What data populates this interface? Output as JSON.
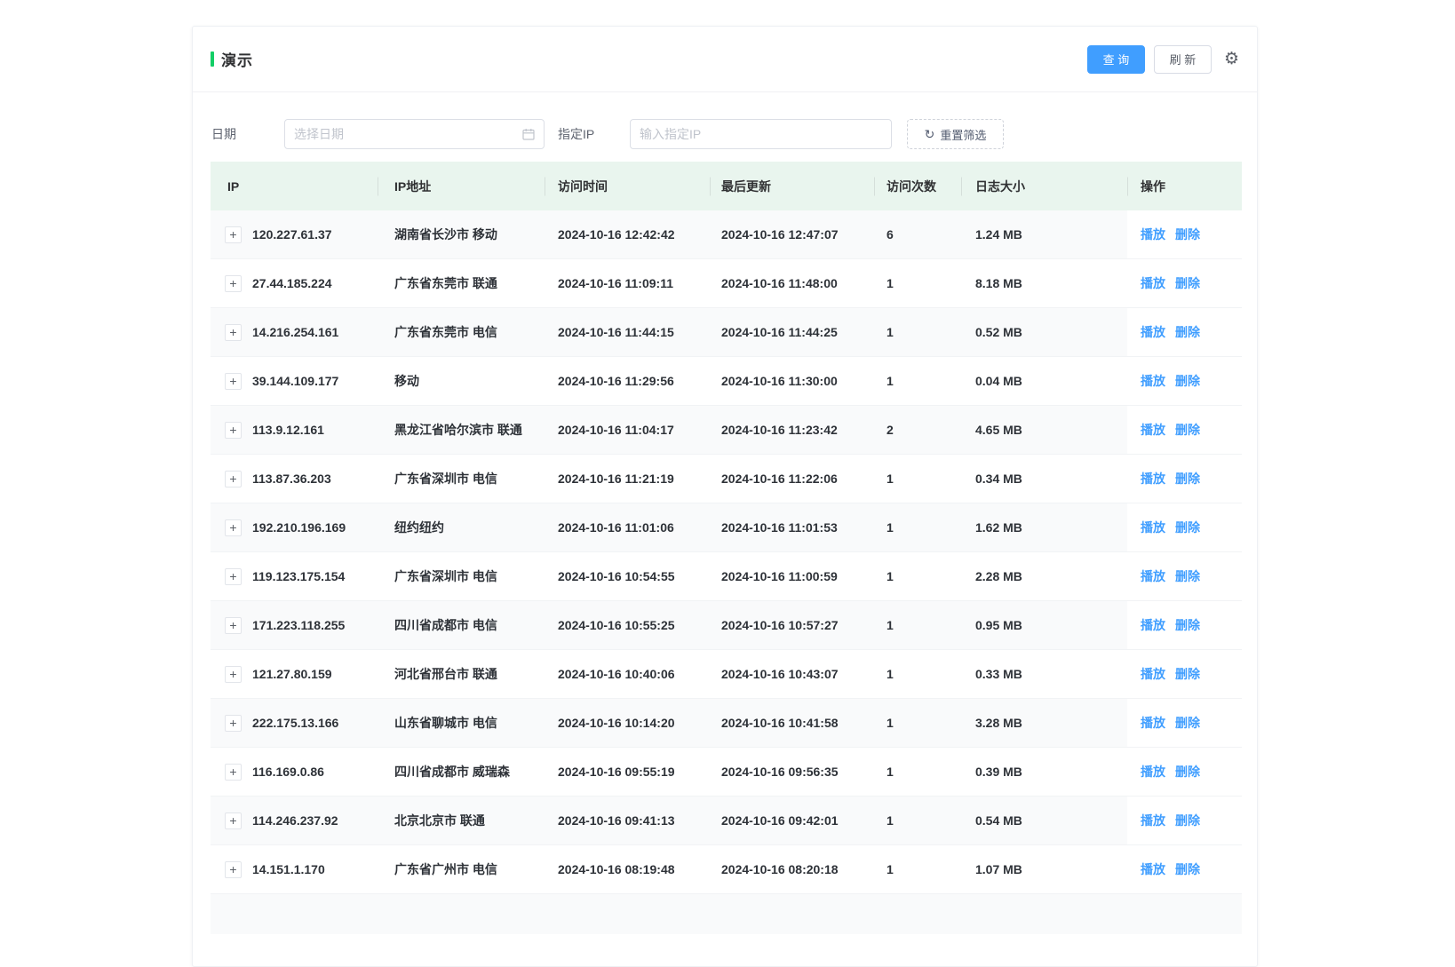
{
  "page": {
    "title": "演示"
  },
  "colors": {
    "accent_green": "#13ce66",
    "primary_blue": "#409eff",
    "table_header_bg": "#e9f5ee",
    "stripe_bg": "#f9fafb",
    "link_blue": "#409eff"
  },
  "toolbar": {
    "query_label": "查 询",
    "refresh_label": "刷 新",
    "settings_icon": "gear-icon"
  },
  "filters": {
    "date_label": "日期",
    "date_placeholder": "选择日期",
    "date_value": "",
    "date_icon": "calendar-icon",
    "ip_label": "指定IP",
    "ip_placeholder": "输入指定IP",
    "ip_value": "",
    "reset_label": "重置筛选",
    "reset_icon": "refresh-icon"
  },
  "table": {
    "expand_icon": "plus-icon",
    "columns": [
      "IP",
      "IP地址",
      "访问时间",
      "最后更新",
      "访问次数",
      "日志大小",
      "操作"
    ],
    "actions": {
      "play": "播放",
      "delete": "删除"
    },
    "rows": [
      {
        "ip": "120.227.61.37",
        "location": "湖南省长沙市 移动",
        "visit_time": "2024-10-16 12:42:42",
        "last_update": "2024-10-16 12:47:07",
        "visits": "6",
        "log_size": "1.24 MB"
      },
      {
        "ip": "27.44.185.224",
        "location": "广东省东莞市 联通",
        "visit_time": "2024-10-16 11:09:11",
        "last_update": "2024-10-16 11:48:00",
        "visits": "1",
        "log_size": "8.18 MB"
      },
      {
        "ip": "14.216.254.161",
        "location": "广东省东莞市 电信",
        "visit_time": "2024-10-16 11:44:15",
        "last_update": "2024-10-16 11:44:25",
        "visits": "1",
        "log_size": "0.52 MB"
      },
      {
        "ip": "39.144.109.177",
        "location": "移动",
        "visit_time": "2024-10-16 11:29:56",
        "last_update": "2024-10-16 11:30:00",
        "visits": "1",
        "log_size": "0.04 MB"
      },
      {
        "ip": "113.9.12.161",
        "location": "黑龙江省哈尔滨市 联通",
        "visit_time": "2024-10-16 11:04:17",
        "last_update": "2024-10-16 11:23:42",
        "visits": "2",
        "log_size": "4.65 MB"
      },
      {
        "ip": "113.87.36.203",
        "location": "广东省深圳市 电信",
        "visit_time": "2024-10-16 11:21:19",
        "last_update": "2024-10-16 11:22:06",
        "visits": "1",
        "log_size": "0.34 MB"
      },
      {
        "ip": "192.210.196.169",
        "location": "纽约纽约",
        "visit_time": "2024-10-16 11:01:06",
        "last_update": "2024-10-16 11:01:53",
        "visits": "1",
        "log_size": "1.62 MB"
      },
      {
        "ip": "119.123.175.154",
        "location": "广东省深圳市 电信",
        "visit_time": "2024-10-16 10:54:55",
        "last_update": "2024-10-16 11:00:59",
        "visits": "1",
        "log_size": "2.28 MB"
      },
      {
        "ip": "171.223.118.255",
        "location": "四川省成都市 电信",
        "visit_time": "2024-10-16 10:55:25",
        "last_update": "2024-10-16 10:57:27",
        "visits": "1",
        "log_size": "0.95 MB"
      },
      {
        "ip": "121.27.80.159",
        "location": "河北省邢台市 联通",
        "visit_time": "2024-10-16 10:40:06",
        "last_update": "2024-10-16 10:43:07",
        "visits": "1",
        "log_size": "0.33 MB"
      },
      {
        "ip": "222.175.13.166",
        "location": "山东省聊城市 电信",
        "visit_time": "2024-10-16 10:14:20",
        "last_update": "2024-10-16 10:41:58",
        "visits": "1",
        "log_size": "3.28 MB"
      },
      {
        "ip": "116.169.0.86",
        "location": "四川省成都市 威瑞森",
        "visit_time": "2024-10-16 09:55:19",
        "last_update": "2024-10-16 09:56:35",
        "visits": "1",
        "log_size": "0.39 MB"
      },
      {
        "ip": "114.246.237.92",
        "location": "北京北京市 联通",
        "visit_time": "2024-10-16 09:41:13",
        "last_update": "2024-10-16 09:42:01",
        "visits": "1",
        "log_size": "0.54 MB"
      },
      {
        "ip": "14.151.1.170",
        "location": "广东省广州市 电信",
        "visit_time": "2024-10-16 08:19:48",
        "last_update": "2024-10-16 08:20:18",
        "visits": "1",
        "log_size": "1.07 MB"
      }
    ]
  }
}
